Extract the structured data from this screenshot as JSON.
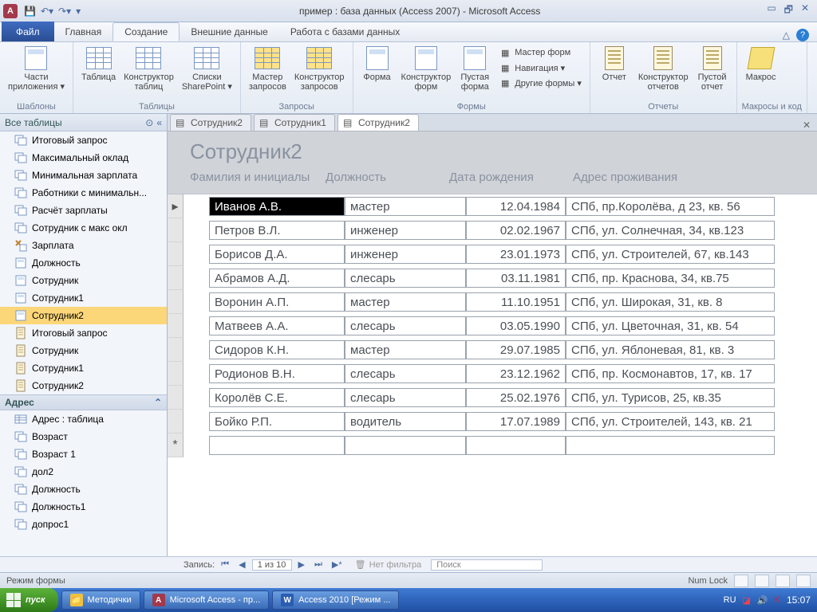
{
  "title": "пример : база данных (Access 2007)  -  Microsoft Access",
  "tabs": {
    "file": "Файл",
    "items": [
      "Главная",
      "Создание",
      "Внешние данные",
      "Работа с базами данных"
    ],
    "active_index": 1
  },
  "ribbon": {
    "groups": [
      {
        "label": "Шаблоны",
        "buttons": [
          {
            "label": "Части\nприложения ▾"
          }
        ]
      },
      {
        "label": "Таблицы",
        "buttons": [
          {
            "label": "Таблица"
          },
          {
            "label": "Конструктор\nтаблиц"
          },
          {
            "label": "Списки\nSharePoint ▾"
          }
        ]
      },
      {
        "label": "Запросы",
        "buttons": [
          {
            "label": "Мастер\nзапросов"
          },
          {
            "label": "Конструктор\nзапросов"
          }
        ]
      },
      {
        "label": "Формы",
        "buttons": [
          {
            "label": "Форма"
          },
          {
            "label": "Конструктор\nформ"
          },
          {
            "label": "Пустая\nформа"
          }
        ],
        "small": [
          "Мастер форм",
          "Навигация ▾",
          "Другие формы ▾"
        ]
      },
      {
        "label": "Отчеты",
        "buttons": [
          {
            "label": "Отчет"
          },
          {
            "label": "Конструктор\nотчетов"
          },
          {
            "label": "Пустой\nотчет"
          }
        ]
      },
      {
        "label": "Макросы и код",
        "buttons": [
          {
            "label": "Макрос"
          }
        ]
      }
    ]
  },
  "nav": {
    "header": "Все таблицы",
    "items1": [
      {
        "t": "q",
        "label": "Итоговый запрос"
      },
      {
        "t": "q",
        "label": "Максимальный оклад"
      },
      {
        "t": "q",
        "label": "Минимальная зарплата"
      },
      {
        "t": "q",
        "label": "Работники с минимальн..."
      },
      {
        "t": "q",
        "label": "Расчёт зарплаты"
      },
      {
        "t": "q",
        "label": "Сотрудник с макс окл"
      },
      {
        "t": "q2",
        "label": "Зарплата"
      },
      {
        "t": "f",
        "label": "Должность"
      },
      {
        "t": "f",
        "label": "Сотрудник"
      },
      {
        "t": "f",
        "label": "Сотрудник1"
      },
      {
        "t": "f",
        "label": "Сотрудник2",
        "selected": true
      },
      {
        "t": "r",
        "label": "Итоговый запрос"
      },
      {
        "t": "r",
        "label": "Сотрудник"
      },
      {
        "t": "r",
        "label": "Сотрудник1"
      },
      {
        "t": "r",
        "label": "Сотрудник2"
      }
    ],
    "group2": "Адрес",
    "items2": [
      {
        "t": "t",
        "label": "Адрес : таблица"
      },
      {
        "t": "q",
        "label": "Возраст"
      },
      {
        "t": "q",
        "label": "Возраст 1"
      },
      {
        "t": "q",
        "label": "дол2"
      },
      {
        "t": "q",
        "label": "Должность"
      },
      {
        "t": "q",
        "label": "Должность1"
      },
      {
        "t": "q",
        "label": "допрос1"
      }
    ]
  },
  "doctabs": [
    {
      "label": "Сотрудник2",
      "active": false
    },
    {
      "label": "Сотрудник1",
      "active": false
    },
    {
      "label": "Сотрудник2",
      "active": true
    }
  ],
  "form": {
    "title": "Сотрудник2",
    "columns": [
      "Фамилия и инициалы",
      "Должность",
      "Дата рождения",
      "Адрес проживания"
    ],
    "rows": [
      {
        "name": "Иванов А.В.",
        "pos": "мастер",
        "dob": "12.04.1984",
        "addr": "СПб, пр.Королёва, д 23, кв. 56",
        "current": true
      },
      {
        "name": "Петров В.Л.",
        "pos": "инженер",
        "dob": "02.02.1967",
        "addr": "СПб, ул. Солнечная, 34, кв.123"
      },
      {
        "name": "Борисов Д.А.",
        "pos": "инженер",
        "dob": "23.01.1973",
        "addr": "СПб, ул. Строителей, 67, кв.143"
      },
      {
        "name": "Абрамов А.Д.",
        "pos": "слесарь",
        "dob": "03.11.1981",
        "addr": "СПб, пр. Краснова, 34, кв.75"
      },
      {
        "name": "Воронин А.П.",
        "pos": "мастер",
        "dob": "11.10.1951",
        "addr": "СПб, ул. Широкая, 31, кв. 8"
      },
      {
        "name": "Матвеев А.А.",
        "pos": "слесарь",
        "dob": "03.05.1990",
        "addr": "СПб, ул. Цветочная, 31, кв. 54"
      },
      {
        "name": "Сидоров К.Н.",
        "pos": "мастер",
        "dob": "29.07.1985",
        "addr": "СПб, ул. Яблоневая, 81, кв. 3"
      },
      {
        "name": "Родионов В.Н.",
        "pos": "слесарь",
        "dob": "23.12.1962",
        "addr": "СПб, пр. Космонавтов, 17, кв. 17"
      },
      {
        "name": "Королёв С.Е.",
        "pos": "слесарь",
        "dob": "25.02.1976",
        "addr": "СПб, ул. Турисов, 25, кв.35"
      },
      {
        "name": "Бойко Р.П.",
        "pos": "водитель",
        "dob": "17.07.1989",
        "addr": "СПб, ул. Строителей, 143, кв. 21"
      }
    ]
  },
  "recnav": {
    "label": "Запись:",
    "position": "1 из 10",
    "nofilter": "Нет фильтра",
    "search": "Поиск"
  },
  "status": {
    "mode": "Режим формы",
    "numlock": "Num Lock"
  },
  "taskbar": {
    "start": "пуск",
    "buttons": [
      {
        "icon": "folder",
        "label": "Методички"
      },
      {
        "icon": "access",
        "label": "Microsoft Access - пр..."
      },
      {
        "icon": "word",
        "label": "Access 2010 [Режим ..."
      }
    ],
    "lang": "RU",
    "time": "15:07"
  }
}
